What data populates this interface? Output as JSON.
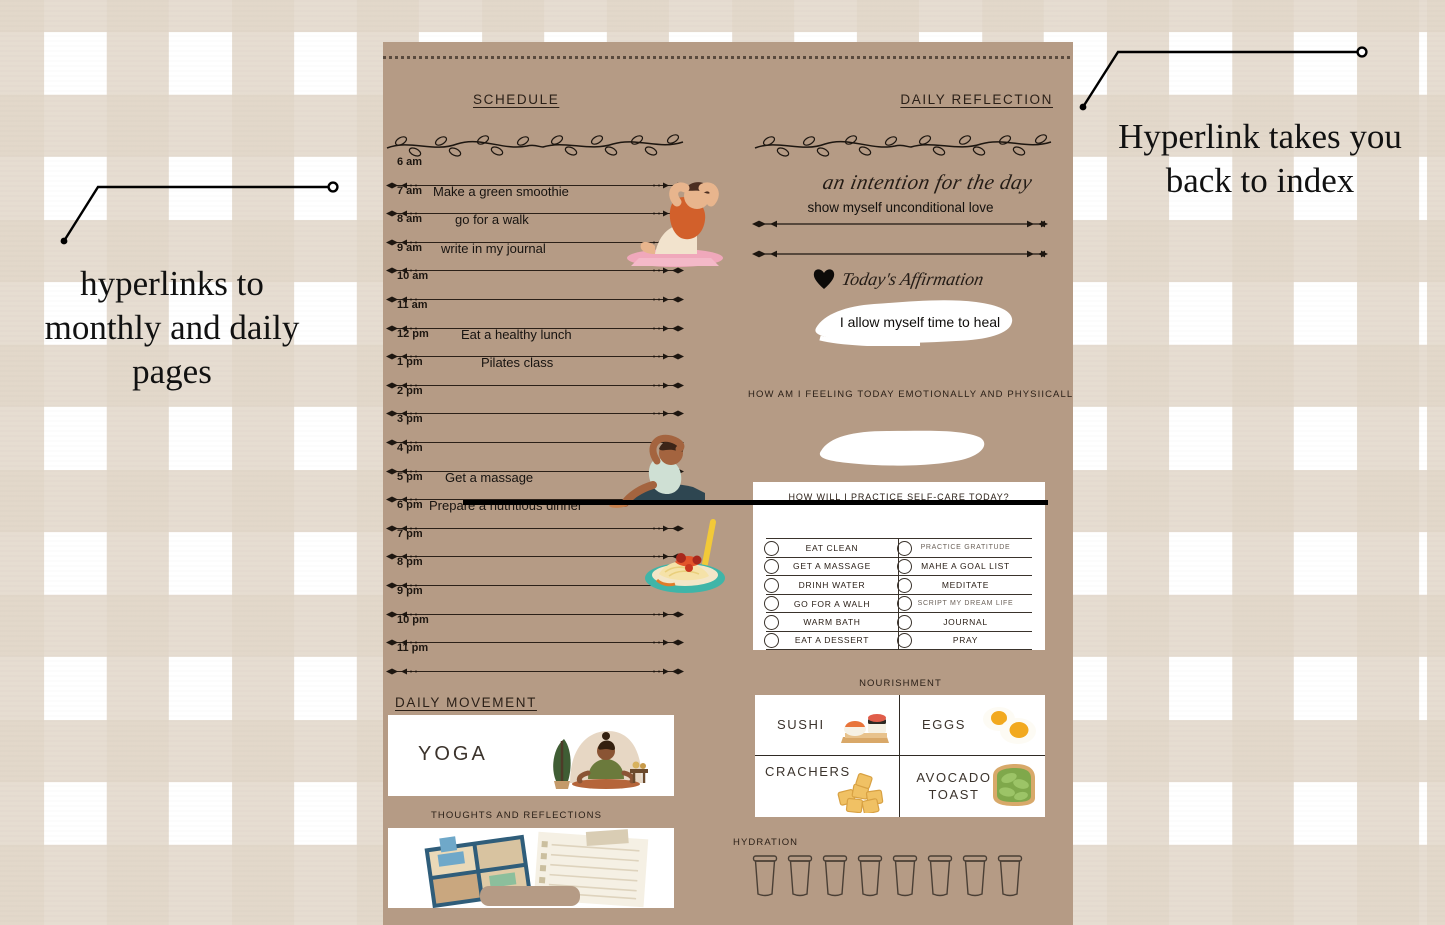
{
  "annotations": {
    "left": "hyperlinks to monthly and daily pages",
    "right": "Hyperlink takes you back to index"
  },
  "schedule": {
    "title": "SCHEDULE",
    "rows": [
      {
        "time": "6 am",
        "task": ""
      },
      {
        "time": "7 am",
        "task": "Make a green smoothie"
      },
      {
        "time": "8 am",
        "task": "go for a walk"
      },
      {
        "time": "9 am",
        "task": "write in my journal"
      },
      {
        "time": "10 am",
        "task": ""
      },
      {
        "time": "11 am",
        "task": ""
      },
      {
        "time": "12 pm",
        "task": "Eat a healthy lunch"
      },
      {
        "time": "1 pm",
        "task": "Pilates class"
      },
      {
        "time": "2 pm",
        "task": ""
      },
      {
        "time": "3 pm",
        "task": ""
      },
      {
        "time": "4 pm",
        "task": ""
      },
      {
        "time": "5 pm",
        "task": "Get a massage"
      },
      {
        "time": "6 pm",
        "task": "Prepare a nutritious dinner"
      },
      {
        "time": "7 pm",
        "task": ""
      },
      {
        "time": "8 pm",
        "task": ""
      },
      {
        "time": "9 pm",
        "task": ""
      },
      {
        "time": "10 pm",
        "task": ""
      },
      {
        "time": "11 pm",
        "task": ""
      }
    ]
  },
  "daily_movement": {
    "title": "DAILY MOVEMENT",
    "activity": "YOGA",
    "thoughts_title": "THOUGHTS AND REFLECTIONS"
  },
  "reflection": {
    "title": "DAILY REFLECTION",
    "intention_label": "an intention for the day",
    "intention_value": "show myself unconditional love",
    "affirmation_label": "Today's Affirmation",
    "affirmation_value": "I allow myself time to heal",
    "feeling_question": "HOW AM I FEELING TODAY EMOTIONALLY AND PHYSIICALLY?"
  },
  "self_care": {
    "title": "HOW WILL I PRACTICE SELF-CARE TODAY?",
    "left_items": [
      "EAT CLEAN",
      "GET A MASSAGE",
      "DRINH WATER",
      "GO FOR A WALH",
      "WARM BATH",
      "EAT A DESSERT"
    ],
    "right_items": [
      "PRACTICE GRATITUDE",
      "MAHE A GOAL LIST",
      "MEDITATE",
      "SCRIPT MY DREAM LIFE",
      "JOURNAL",
      "PRAY"
    ]
  },
  "nourishment": {
    "title": "NOURISHMENT",
    "items": [
      "SUSHI",
      "EGGS",
      "CRACHERS",
      "AVOCADO TOAST"
    ]
  },
  "hydration": {
    "title": "HYDRATION",
    "cup_count": 8,
    "cups_filled": 0
  },
  "colors": {
    "page_background": "#b59b85",
    "gingham_stripe": "#e2d7c9",
    "ink": "#1d1610",
    "card_white": "#ffffff"
  }
}
